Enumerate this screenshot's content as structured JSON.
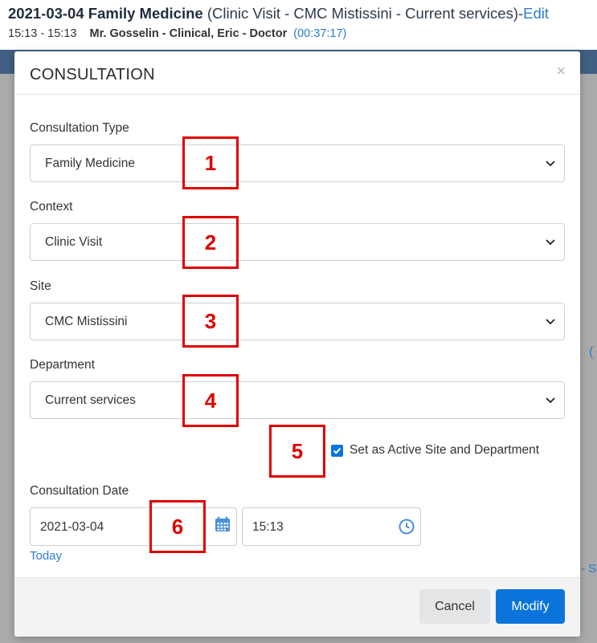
{
  "background": {
    "date": "2021-03-04",
    "consultation_type": "Family Medicine",
    "context_text": "(Clinic Visit - CMC Mistissini - Current services)-",
    "edit_link": "Edit",
    "time_range": "15:13  - 15:13",
    "practitioner": "Mr. Gosselin - Clinical, Eric - Doctor",
    "duration": "(00:37:17)",
    "edge_right_1": "(",
    "edge_right_2": "- S"
  },
  "modal": {
    "title": "CONSULTATION",
    "close_symbol": "×",
    "fields": {
      "consultation_type": {
        "label": "Consultation Type",
        "value": "Family Medicine"
      },
      "context": {
        "label": "Context",
        "value": "Clinic Visit"
      },
      "site": {
        "label": "Site",
        "value": "CMC Mistissini"
      },
      "department": {
        "label": "Department",
        "value": "Current services"
      }
    },
    "active_site_checkbox": {
      "label": "Set as Active Site and Department",
      "checked": true
    },
    "consultation_date": {
      "label": "Consultation Date",
      "date": "2021-03-04",
      "time": "15:13",
      "today_link": "Today"
    },
    "buttons": {
      "cancel": "Cancel",
      "modify": "Modify"
    }
  },
  "callouts": [
    "1",
    "2",
    "3",
    "4",
    "5",
    "6"
  ],
  "colors": {
    "primary": "#0a74da",
    "callout": "#e00000",
    "link": "#2a7ad2",
    "header_bar": "#0b4f9b"
  },
  "icons": {
    "select_arrow": "chevron-down-icon",
    "date": "calendar-icon",
    "time": "clock-icon",
    "close": "close-icon",
    "checkbox": "check-icon"
  }
}
